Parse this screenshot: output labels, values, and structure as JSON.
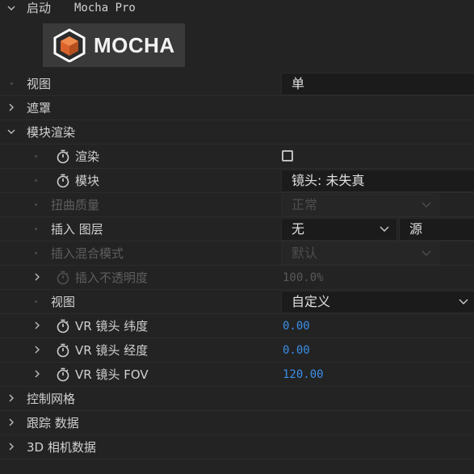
{
  "header": {
    "expand_icon": "chevron-down",
    "title": "启动",
    "plugin": "Mocha Pro"
  },
  "logo": {
    "text": "MOCHA",
    "cube_color": "#d9622b"
  },
  "rows": {
    "view": {
      "label": "视图",
      "value": "单"
    },
    "mask": {
      "label": "遮罩"
    },
    "module_render": {
      "label": "模块渲染"
    },
    "render": {
      "label": "渲染",
      "checked": false
    },
    "module": {
      "label": "模块",
      "value": "镜头: 未失真"
    },
    "distortion_quality": {
      "label": "扭曲质量",
      "value": "正常"
    },
    "insert_layer": {
      "label": "插入 图层",
      "value": "无",
      "source": "源"
    },
    "insert_blend": {
      "label": "插入混合模式",
      "value": "默认"
    },
    "insert_opacity": {
      "label": "插入不透明度",
      "value": "100.0%"
    },
    "view2": {
      "label": "视图",
      "value": "自定义"
    },
    "vr_lat": {
      "label": "VR 镜头 纬度",
      "value": "0.00"
    },
    "vr_lon": {
      "label": "VR 镜头 经度",
      "value": "0.00"
    },
    "vr_fov": {
      "label": "VR 镜头 FOV",
      "value": "120.00"
    },
    "control_grid": {
      "label": "控制网格"
    },
    "tracking_data": {
      "label": "跟踪 数据"
    },
    "camera_3d": {
      "label": "3D 相机数据"
    }
  },
  "colors": {
    "accent_value": "#3b8fe8",
    "background": "#232323"
  }
}
